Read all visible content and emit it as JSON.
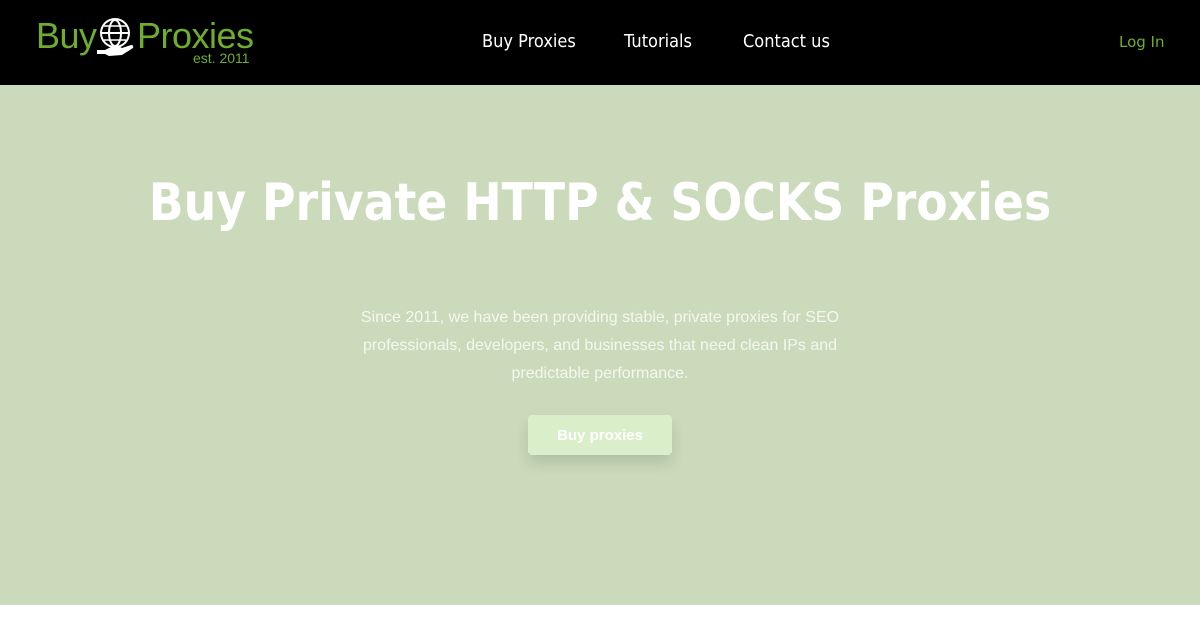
{
  "header": {
    "logo": {
      "word_buy": "Buy",
      "word_proxies": "Proxies",
      "est": "est. 2011",
      "icon": "globe-hand-icon",
      "color": "#6fae2c"
    },
    "nav": [
      {
        "label": "Buy Proxies"
      },
      {
        "label": "Tutorials"
      },
      {
        "label": "Contact us"
      }
    ],
    "login_label": "Log In",
    "background": "#000000"
  },
  "hero": {
    "title": "Buy Private HTTP & SOCKS Proxies",
    "description": "Since 2011, we have been providing stable, private proxies for SEO professionals, developers, and businesses that need clean IPs and predictable performance.",
    "cta_label": "Buy proxies",
    "background": "#cbdabb",
    "cta_color": "#dbeeca"
  }
}
